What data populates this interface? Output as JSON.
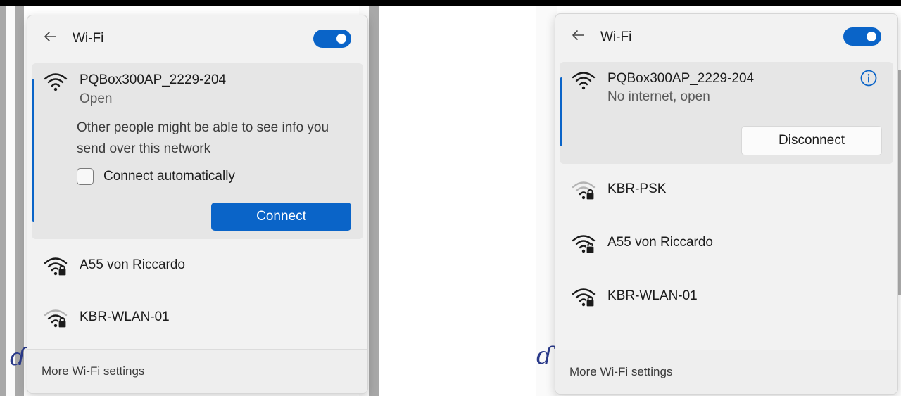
{
  "left_panel": {
    "header": {
      "title": "Wi-Fi",
      "toggle_state": "on"
    },
    "expanded_network": {
      "name": "PQBox300AP_2229-204",
      "status": "Open",
      "warning": "Other people might be able to see info you send over this network",
      "checkbox_label": "Connect automatically",
      "checkbox_checked": false,
      "connect_label": "Connect"
    },
    "networks": [
      {
        "name": "A55 von Riccardo",
        "icon": "wifi-locked-icon",
        "signal": "full"
      },
      {
        "name": "KBR-WLAN-01",
        "icon": "wifi-locked-icon",
        "signal": "partial"
      }
    ],
    "footer": {
      "link": "More Wi-Fi settings"
    }
  },
  "right_panel": {
    "header": {
      "title": "Wi-Fi",
      "toggle_state": "on"
    },
    "connected_network": {
      "name": "PQBox300AP_2229-204",
      "status": "No internet, open",
      "disconnect_label": "Disconnect",
      "info_icon": "info-icon"
    },
    "networks": [
      {
        "name": "KBR-PSK",
        "icon": "wifi-locked-icon",
        "signal": "weak"
      },
      {
        "name": "A55 von Riccardo",
        "icon": "wifi-locked-icon",
        "signal": "full"
      },
      {
        "name": "KBR-WLAN-01",
        "icon": "wifi-locked-icon",
        "signal": "full"
      }
    ],
    "footer": {
      "link": "More Wi-Fi settings"
    }
  },
  "colors": {
    "accent": "#0a64c8",
    "panel_bg": "#f2f2f2",
    "selected_bg": "#e6e6e6"
  }
}
